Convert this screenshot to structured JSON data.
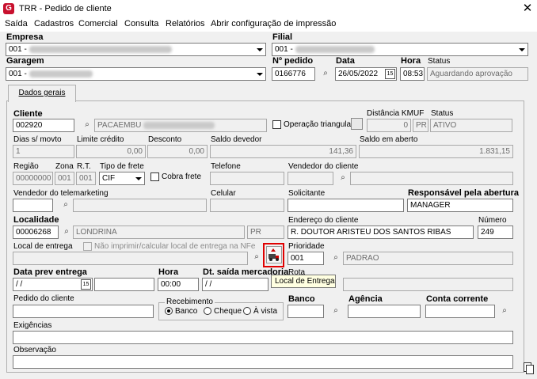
{
  "window": {
    "title": "TRR - Pedido de cliente",
    "close_glyph": "✕"
  },
  "menu": [
    "Saída",
    "Cadastros",
    "Comercial",
    "Consulta",
    "Relatórios",
    "Abrir configuração de impressão"
  ],
  "header": {
    "empresa": {
      "label": "Empresa",
      "code": "001"
    },
    "filial": {
      "label": "Filial",
      "code": "001"
    },
    "garagem": {
      "label": "Garagem",
      "code": "001"
    },
    "pedido": {
      "label": "Nº pedido",
      "value": "0166776"
    },
    "data": {
      "label": "Data",
      "value": "26/05/2022"
    },
    "hora": {
      "label": "Hora",
      "value": "08:53"
    },
    "status": {
      "label": "Status",
      "value": "Aguardando aprovação"
    }
  },
  "tab": {
    "label": "Dados gerais"
  },
  "cliente": {
    "label": "Cliente",
    "code": "002920",
    "name": "PACAEMBU",
    "operacao_triangular": "Operação triangular",
    "distancia_label": "Distância KM",
    "distancia": "0",
    "uf_label": "UF",
    "uf": "PR",
    "status_label": "Status",
    "status": "ATIVO"
  },
  "financeiro": {
    "dias_label": "Dias s/ movto",
    "dias": "1",
    "limite_label": "Limite crédito",
    "limite": "0,00",
    "desconto_label": "Desconto",
    "desconto": "0,00",
    "saldo_devedor_label": "Saldo devedor",
    "saldo_devedor": "141,36",
    "saldo_aberto_label": "Saldo em aberto",
    "saldo_aberto": "1.831,15"
  },
  "regiao": {
    "regiao_label": "Região",
    "regiao": "00000000",
    "zona_label": "Zona",
    "zona": "001",
    "rt_label": "R.T.",
    "rt": "001",
    "frete_label": "Tipo de frete",
    "frete": "CIF",
    "cobra_frete": "Cobra frete",
    "telefone_label": "Telefone",
    "vendedor_cliente_label": "Vendedor do cliente"
  },
  "vendas": {
    "vendedor_tele_label": "Vendedor do telemarketing",
    "celular_label": "Celular",
    "solicitante_label": "Solicitante",
    "responsavel_label": "Responsável pela abertura",
    "responsavel": "MANAGER"
  },
  "localidade": {
    "label": "Localidade",
    "code": "00006268",
    "name": "LONDRINA",
    "uf": "PR",
    "endereco_label": "Endereço do cliente",
    "endereco": "R. DOUTOR ARISTEU DOS SANTOS RIBAS",
    "numero_label": "Número",
    "numero": "249"
  },
  "entrega": {
    "local_label": "Local de entrega",
    "nao_imprimir": "Não imprimir/calcular local de entrega na NFe",
    "prioridade_label": "Prioridade",
    "prioridade_code": "001",
    "prioridade_name": "PADRAO",
    "tooltip": "Local de Entrega"
  },
  "datas": {
    "prev_label": "Data prev entrega",
    "prev": " / /",
    "hora_label": "Hora",
    "hora": "00:00",
    "saida_label": "Dt. saída mercadoria",
    "saida": " / /",
    "rota_label": "Rota"
  },
  "pagamento": {
    "pedido_cliente_label": "Pedido do cliente",
    "recebimento_label": "Recebimento",
    "opcoes": [
      "Banco",
      "Cheque",
      "À vista"
    ],
    "banco_label": "Banco",
    "agencia_label": "Agência",
    "conta_label": "Conta corrente"
  },
  "extras": {
    "exigencias_label": "Exigências",
    "observacao_label": "Observação"
  },
  "icons": {
    "binoculars": "⌕",
    "calendar": "15"
  }
}
